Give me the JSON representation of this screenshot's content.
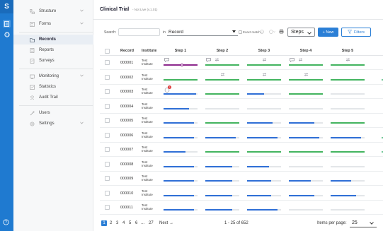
{
  "rail": {
    "logo": "S",
    "icons": [
      "document-icon",
      "globe-icon"
    ],
    "help": "help-icon"
  },
  "sidebar": {
    "items": [
      {
        "label": "Structure",
        "icon": "structure-icon",
        "chevron": true
      },
      {
        "label": "Forms",
        "icon": "forms-icon",
        "chevron": true
      },
      {
        "label": "Records",
        "icon": "records-icon",
        "active": true
      },
      {
        "label": "Reports",
        "icon": "reports-icon"
      },
      {
        "label": "Surveys",
        "icon": "surveys-icon"
      },
      {
        "label": "Monitoring",
        "icon": "monitoring-icon",
        "chevron": true
      },
      {
        "label": "Statistics",
        "icon": "statistics-icon"
      },
      {
        "label": "Audit Trail",
        "icon": "audit-icon"
      },
      {
        "label": "Users",
        "icon": "users-icon"
      },
      {
        "label": "Settings",
        "icon": "settings-icon",
        "chevron": true
      }
    ]
  },
  "header": {
    "title": "Clinical Trial",
    "subtitle": "- Not Live (v.1.01)"
  },
  "toolbar": {
    "search_label": "Search:",
    "search_value": "",
    "in_label": "in",
    "scope_value": "Record",
    "exact_match_label": "Exact match",
    "steps_value": "Steps",
    "new_label": "+ New",
    "filters_label": "Filters"
  },
  "table": {
    "columns": [
      "Record",
      "Institute",
      "Step 1",
      "Step 2",
      "Step 3",
      "Step 4",
      "Step 5"
    ],
    "colors": {
      "blue": "#2f6fd6",
      "green": "#43b45f",
      "purple": "#8d2a8d",
      "track": "#e3e6e9"
    },
    "rows": [
      {
        "record": "000001",
        "institute": "Test Institute",
        "steps": [
          [
            "purple",
            1.0
          ],
          [
            "green",
            1.0
          ],
          [
            "green",
            1.0
          ],
          [
            "green",
            1.0
          ],
          [
            "green",
            1.0
          ]
        ]
      },
      {
        "record": "000002",
        "institute": "Test Institute",
        "steps": [
          [
            "green",
            1.0
          ],
          [
            "green",
            1.0
          ],
          [
            "green",
            1.0
          ],
          [
            "green",
            1.0
          ],
          [
            "green",
            1.0
          ]
        ]
      },
      {
        "record": "000003",
        "institute": "Test Institute",
        "steps": [
          [
            "blue",
            0.95
          ],
          [
            "green",
            1.0
          ],
          [
            "blue",
            0.5
          ],
          [
            "green",
            1.0
          ],
          [
            "none",
            0
          ]
        ]
      },
      {
        "record": "000004",
        "institute": "Test Institute",
        "steps": [
          [
            "blue",
            0.75
          ],
          [
            "none",
            0
          ],
          [
            "none",
            0
          ],
          [
            "none",
            0
          ],
          [
            "none",
            0
          ]
        ]
      },
      {
        "record": "000005",
        "institute": "Test Institute",
        "steps": [
          [
            "blue",
            0.9
          ],
          [
            "green",
            1.0
          ],
          [
            "blue",
            0.75
          ],
          [
            "blue",
            0.75
          ],
          [
            "green",
            1.0
          ]
        ]
      },
      {
        "record": "000006",
        "institute": "Test Institute",
        "steps": [
          [
            "blue",
            0.9
          ],
          [
            "blue",
            0.9
          ],
          [
            "blue",
            0.9
          ],
          [
            "blue",
            0.9
          ],
          [
            "blue",
            0.9
          ]
        ]
      },
      {
        "record": "000007",
        "institute": "Test Institute",
        "steps": [
          [
            "blue",
            0.65
          ],
          [
            "green",
            1.0
          ],
          [
            "green",
            1.0
          ],
          [
            "green",
            1.0
          ],
          [
            "green",
            1.0
          ]
        ]
      },
      {
        "record": "000008",
        "institute": "Test Institute",
        "steps": [
          [
            "blue",
            0.9
          ],
          [
            "blue",
            0.8
          ],
          [
            "blue",
            0.65
          ],
          [
            "none",
            0
          ],
          [
            "none",
            0
          ]
        ]
      },
      {
        "record": "000009",
        "institute": "Test Institute",
        "steps": [
          [
            "blue",
            0.9
          ],
          [
            "blue",
            0.8
          ],
          [
            "blue",
            0.7
          ],
          [
            "blue",
            0.65
          ],
          [
            "blue",
            0.6
          ]
        ]
      },
      {
        "record": "000010",
        "institute": "Test Institute",
        "steps": [
          [
            "blue",
            0.9
          ],
          [
            "blue",
            0.8
          ],
          [
            "blue",
            0.7
          ],
          [
            "blue",
            0.75
          ],
          [
            "blue",
            0.75
          ]
        ]
      },
      {
        "record": "000011",
        "institute": "Test Institute",
        "steps": [
          [
            "blue",
            0.9
          ],
          [
            "blue",
            0.8
          ],
          [
            "blue",
            0.9
          ],
          [
            "none",
            0
          ],
          [
            "none",
            0
          ]
        ]
      }
    ],
    "step3_alert_count": "2"
  },
  "footer": {
    "pages": [
      "1",
      "2",
      "3",
      "4",
      "5",
      "6",
      "...",
      "27"
    ],
    "active_page": "1",
    "next_label": "Next →",
    "range": "1 - 25 of 652",
    "items_per_page_label": "Items per page:",
    "items_per_page_value": "25"
  }
}
